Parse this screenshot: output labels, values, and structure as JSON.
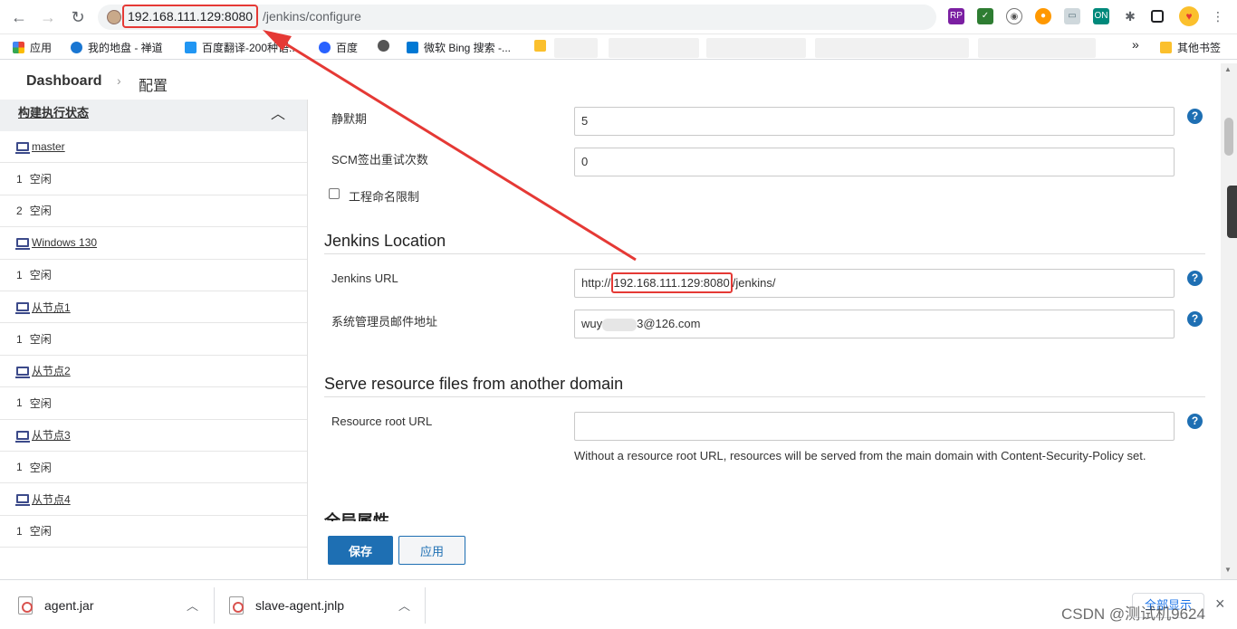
{
  "browser": {
    "url_host": "192.168.111.129:8080",
    "url_path": "/jenkins/configure",
    "extensions": [
      "RP",
      "ON"
    ],
    "bookmarks": [
      "应用",
      "我的地盘 - 禅道",
      "百度翻译-200种语...",
      "百度",
      "微软 Bing 搜索 -...",
      "其他书签"
    ],
    "bookmarks_overflow": "»"
  },
  "breadcrumb": {
    "dashboard": "Dashboard",
    "separator": "›",
    "current": "配置"
  },
  "executors": {
    "title": "构建执行状态",
    "rows": [
      {
        "type": "node",
        "label": "master"
      },
      {
        "type": "exec",
        "index": "1",
        "status": "空闲"
      },
      {
        "type": "exec",
        "index": "2",
        "status": "空闲"
      },
      {
        "type": "node",
        "label": "Windows 130"
      },
      {
        "type": "exec",
        "index": "1",
        "status": "空闲"
      },
      {
        "type": "node",
        "label": "从节点1"
      },
      {
        "type": "exec",
        "index": "1",
        "status": "空闲"
      },
      {
        "type": "node",
        "label": "从节点2"
      },
      {
        "type": "exec",
        "index": "1",
        "status": "空闲"
      },
      {
        "type": "node",
        "label": "从节点3"
      },
      {
        "type": "exec",
        "index": "1",
        "status": "空闲"
      },
      {
        "type": "node",
        "label": "从节点4"
      },
      {
        "type": "exec",
        "index": "1",
        "status": "空闲"
      }
    ]
  },
  "config": {
    "quiet_period": {
      "label": "静默期",
      "value": "5"
    },
    "scm_retry": {
      "label": "SCM签出重试次数",
      "value": "0"
    },
    "project_naming": {
      "label": "工程命名限制"
    },
    "jenkins_location": {
      "heading": "Jenkins Location",
      "url_label": "Jenkins URL",
      "url_prefix": "http://",
      "url_host": "192.168.111.129:8080",
      "url_suffix": "/jenkins/",
      "email_label": "系统管理员邮件地址",
      "email_prefix": "wuy",
      "email_suffix": "3@126.com"
    },
    "resource_domain": {
      "heading": "Serve resource files from another domain",
      "label": "Resource root URL",
      "value": "",
      "description": "Without a resource root URL, resources will be served from the main domain with Content-Security-Policy set."
    },
    "next_section_heading": "全局属性",
    "help_glyph": "?"
  },
  "buttons": {
    "save": "保存",
    "apply": "应用"
  },
  "downloads": {
    "items": [
      {
        "name": "agent.jar"
      },
      {
        "name": "slave-agent.jnlp"
      }
    ],
    "show_all": "全部显示",
    "close": "×"
  },
  "watermark": "CSDN @测试机9624",
  "colors": {
    "accent": "#1e6fb3",
    "annotation": "#e53935"
  }
}
